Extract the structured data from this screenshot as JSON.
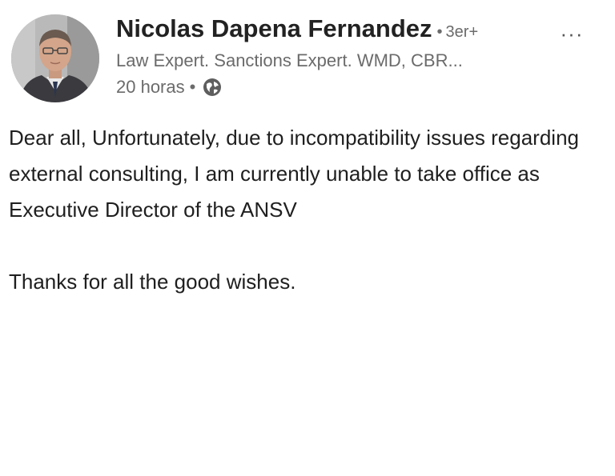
{
  "author": {
    "name": "Nicolas Dapena Fernandez",
    "degree": "3er+",
    "headline": "Law Expert. Sanctions Expert. WMD, CBR...",
    "time": "20 horas"
  },
  "icons": {
    "visibility": "globe-icon",
    "more": "ellipsis-icon"
  },
  "more_label": "···",
  "post": {
    "paragraphs": [
      "Dear all, Unfortunately, due to incompatibility issues regarding external consulting, I am currently unable to take office as Executive Director of the ANSV",
      "Thanks for all the good wishes."
    ]
  },
  "colors": {
    "name": "#222222",
    "secondary": "#6b6b6b",
    "body": "#1f1f1f"
  }
}
